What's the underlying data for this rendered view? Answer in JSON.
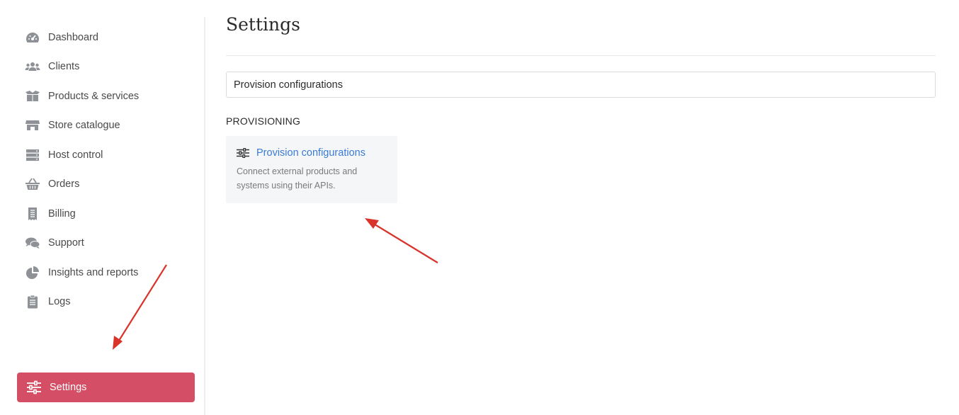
{
  "sidebar": {
    "items": [
      {
        "label": "Dashboard",
        "icon": "gauge-icon"
      },
      {
        "label": "Clients",
        "icon": "users-icon"
      },
      {
        "label": "Products & services",
        "icon": "box-icon"
      },
      {
        "label": "Store catalogue",
        "icon": "store-icon"
      },
      {
        "label": "Host control",
        "icon": "server-icon"
      },
      {
        "label": "Orders",
        "icon": "basket-icon"
      },
      {
        "label": "Billing",
        "icon": "receipt-icon"
      },
      {
        "label": "Support",
        "icon": "chat-icon"
      },
      {
        "label": "Insights and reports",
        "icon": "pie-chart-icon"
      },
      {
        "label": "Logs",
        "icon": "clipboard-icon"
      }
    ],
    "settings": {
      "label": "Settings",
      "icon": "sliders-icon"
    }
  },
  "main": {
    "title": "Settings",
    "search": {
      "value": "Provision configurations"
    },
    "section": "PROVISIONING",
    "card": {
      "title": "Provision configurations",
      "description": "Connect external products and systems using their APIs.",
      "icon": "sliders-icon"
    }
  },
  "colors": {
    "accent": "#d44f65",
    "link": "#3a7bd5",
    "icon": "#8e9196",
    "annotation_arrow": "#d9342b"
  }
}
